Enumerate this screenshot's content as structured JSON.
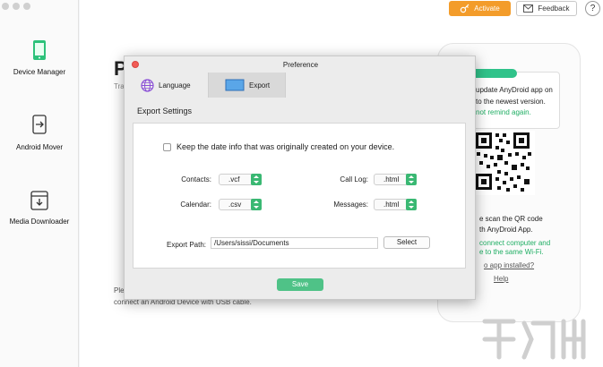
{
  "sidebar": {
    "items": [
      {
        "label": "Device Manager",
        "icon": "phone-icon"
      },
      {
        "label": "Android Mover",
        "icon": "transfer-icon"
      },
      {
        "label": "Media Downloader",
        "icon": "download-icon"
      }
    ]
  },
  "header": {
    "activate_label": "Activate",
    "feedback_label": "Feedback",
    "help_label": "?"
  },
  "background": {
    "title_fragment": "P",
    "sub_fragment": "Tra",
    "bottom_fragment_1": "Ple",
    "bottom_fragment_2": "connect an Android Device with USB cable."
  },
  "phone_panel": {
    "update_line_1": "update AnyDroid app on",
    "update_line_2": "to the newest version.",
    "remind_text": "not remind again.",
    "scan_line_1": "e scan the QR code",
    "scan_line_2": "th AnyDroid App.",
    "connect_line_1": "connect computer and",
    "connect_line_2": "e to the same Wi-Fi.",
    "no_app_link": "o app installed?",
    "help_link": "Help"
  },
  "modal": {
    "title": "Preference",
    "tabs": [
      {
        "label": "Language",
        "icon": "globe-icon"
      },
      {
        "label": "Export",
        "icon": "monitor-icon"
      }
    ],
    "section_title": "Export Settings",
    "keep_date_label": "Keep the date info that was originally created on your device.",
    "fields": {
      "contacts": {
        "label": "Contacts:",
        "value": ".vcf"
      },
      "call_log": {
        "label": "Call Log:",
        "value": ".html"
      },
      "calendar": {
        "label": "Calendar:",
        "value": ".csv"
      },
      "messages": {
        "label": "Messages:",
        "value": ".html"
      }
    },
    "export_path_label": "Export Path:",
    "export_path_value": "/Users/sissi/Documents",
    "select_label": "Select",
    "save_label": "Save"
  },
  "colors": {
    "accent_orange": "#f39c2a",
    "accent_green": "#3ab873",
    "close_red": "#f15b55"
  }
}
